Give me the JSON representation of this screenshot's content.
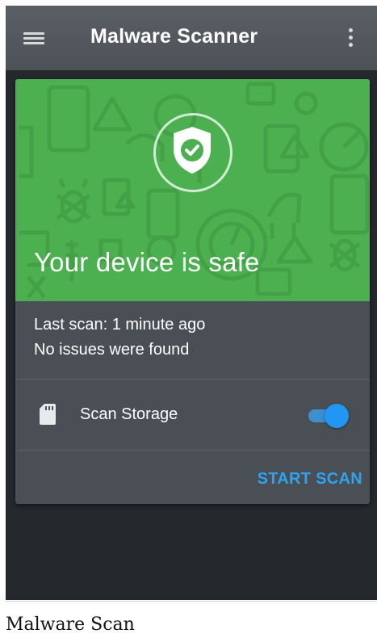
{
  "appbar": {
    "title": "Malware Scanner"
  },
  "hero": {
    "title": "Your device is safe"
  },
  "status": {
    "last_scan": "Last scan: 1 minute ago",
    "issues": "No issues were found"
  },
  "storage": {
    "label": "Scan Storage",
    "enabled": true
  },
  "actions": {
    "start_scan": "START SCAN"
  },
  "caption": "Malware Scan",
  "colors": {
    "appbar": "#52575c",
    "hero_green": "#4caf50",
    "card": "#4a4f55",
    "background": "#25292e",
    "accent_blue": "#2196f3"
  },
  "icons": [
    "menu-icon",
    "more-vert-icon",
    "shield-check-icon",
    "sd-card-icon"
  ]
}
